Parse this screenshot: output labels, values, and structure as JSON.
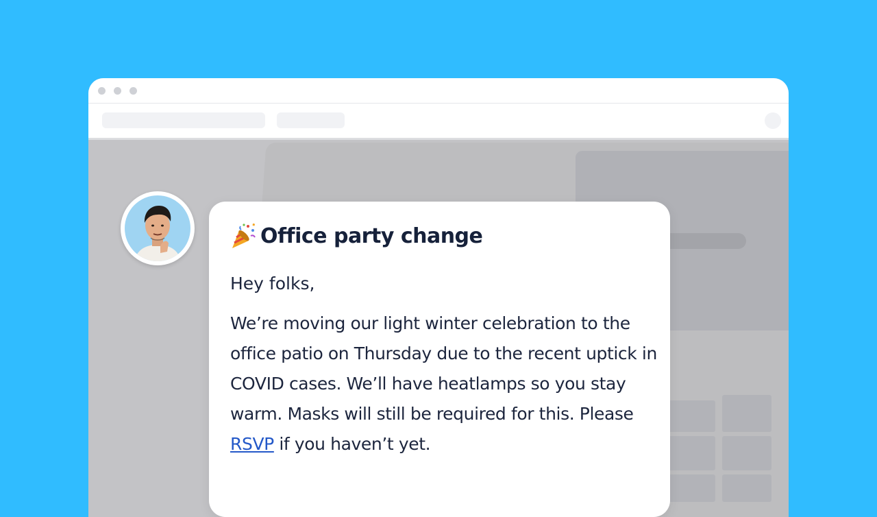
{
  "message": {
    "title": "Office party change",
    "title_emoji": "party-popper-icon",
    "greeting": "Hey folks,",
    "body_before_link": "We’re moving our light winter celebration to the office patio on Thursday due to the recent uptick in COVID cases. We’ll have heatlamps so you stay warm. Masks will still be required for this. Please ",
    "link_label": "RSVP",
    "body_after_link": " if you haven’t yet."
  },
  "colors": {
    "background": "#30bcff",
    "link": "#2358c8",
    "text": "#1c253d"
  }
}
